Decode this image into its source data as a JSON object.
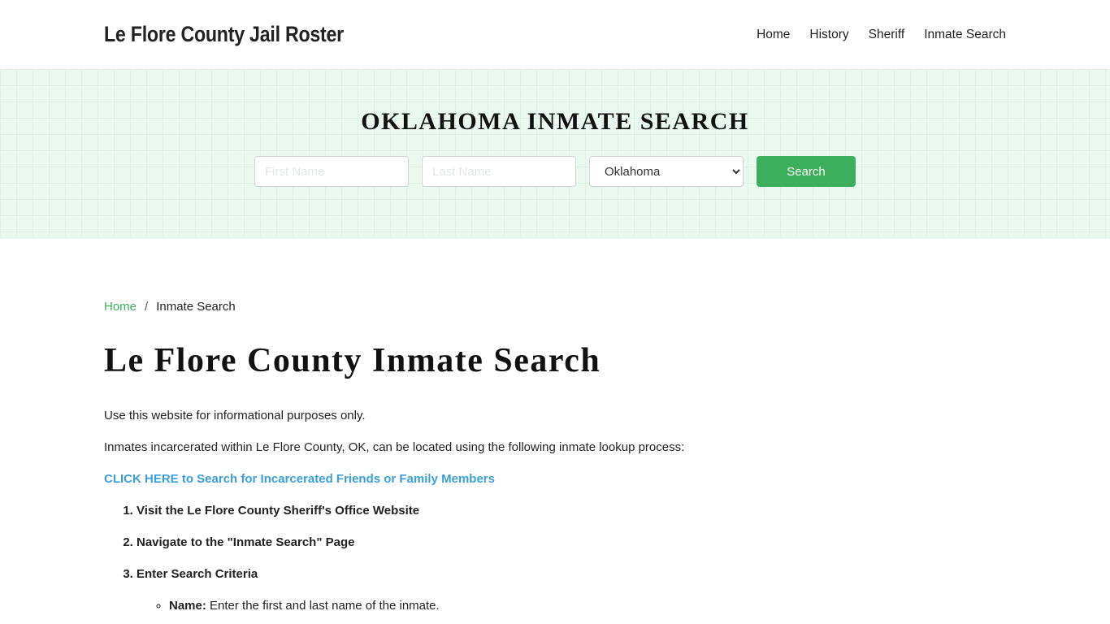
{
  "header": {
    "brand": "Le Flore County Jail Roster",
    "nav": [
      {
        "label": "Home"
      },
      {
        "label": "History"
      },
      {
        "label": "Sheriff"
      },
      {
        "label": "Inmate Search"
      }
    ]
  },
  "banner": {
    "title": "OKLAHOMA INMATE SEARCH",
    "first_name_placeholder": "First Name",
    "first_name_value": "",
    "last_name_placeholder": "Last Name",
    "last_name_value": "",
    "state_selected": "Oklahoma",
    "search_label": "Search"
  },
  "breadcrumb": {
    "home": "Home",
    "separator": "/",
    "current": "Inmate Search"
  },
  "main": {
    "title": "Le Flore County Inmate Search",
    "intro": "Use this website for informational purposes only.",
    "description": "Inmates incarcerated within Le Flore County, OK, can be located using the following inmate lookup process:",
    "cta_link": "CLICK HERE to Search for Incarcerated Friends or Family Members",
    "steps": [
      {
        "label": "Visit the Le Flore County Sheriff's Office Website"
      },
      {
        "label": "Navigate to the \"Inmate Search\" Page"
      },
      {
        "label": "Enter Search Criteria"
      }
    ],
    "criteria": [
      {
        "term": "Name:",
        "text": " Enter the first and last name of the inmate."
      }
    ]
  },
  "colors": {
    "accent_green": "#3cae5c",
    "link_blue": "#3a9fd8",
    "banner_bg": "#eaf8f0"
  }
}
